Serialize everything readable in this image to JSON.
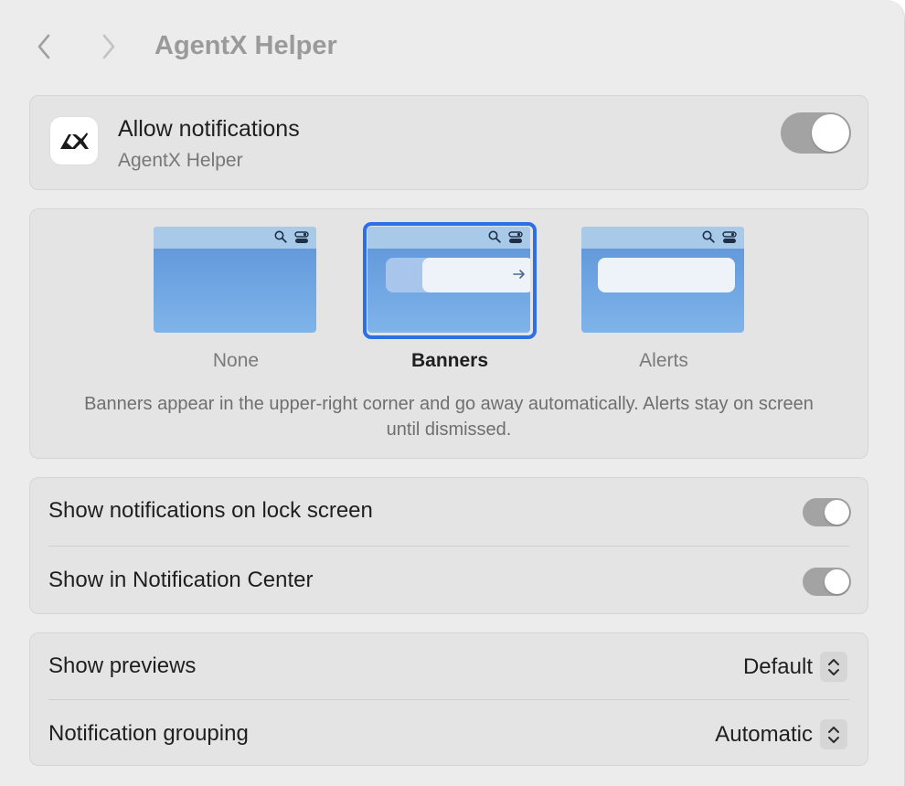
{
  "header": {
    "title": "AgentX Helper"
  },
  "allow": {
    "title": "Allow notifications",
    "app_name": "AgentX Helper",
    "enabled": true
  },
  "alert_style": {
    "options": [
      {
        "label": "None",
        "selected": false
      },
      {
        "label": "Banners",
        "selected": true
      },
      {
        "label": "Alerts",
        "selected": false
      }
    ],
    "description": "Banners appear in the upper-right corner and go away automatically. Alerts stay on screen until dismissed."
  },
  "toggles": {
    "lock_screen": {
      "label": "Show notifications on lock screen",
      "on": true
    },
    "notification_center": {
      "label": "Show in Notification Center",
      "on": true
    }
  },
  "popups": {
    "previews": {
      "label": "Show previews",
      "value": "Default"
    },
    "grouping": {
      "label": "Notification grouping",
      "value": "Automatic"
    }
  },
  "colors": {
    "accent": "#2f6fe6",
    "toggle_track": "#a3a3a3",
    "background": "#ececec"
  }
}
